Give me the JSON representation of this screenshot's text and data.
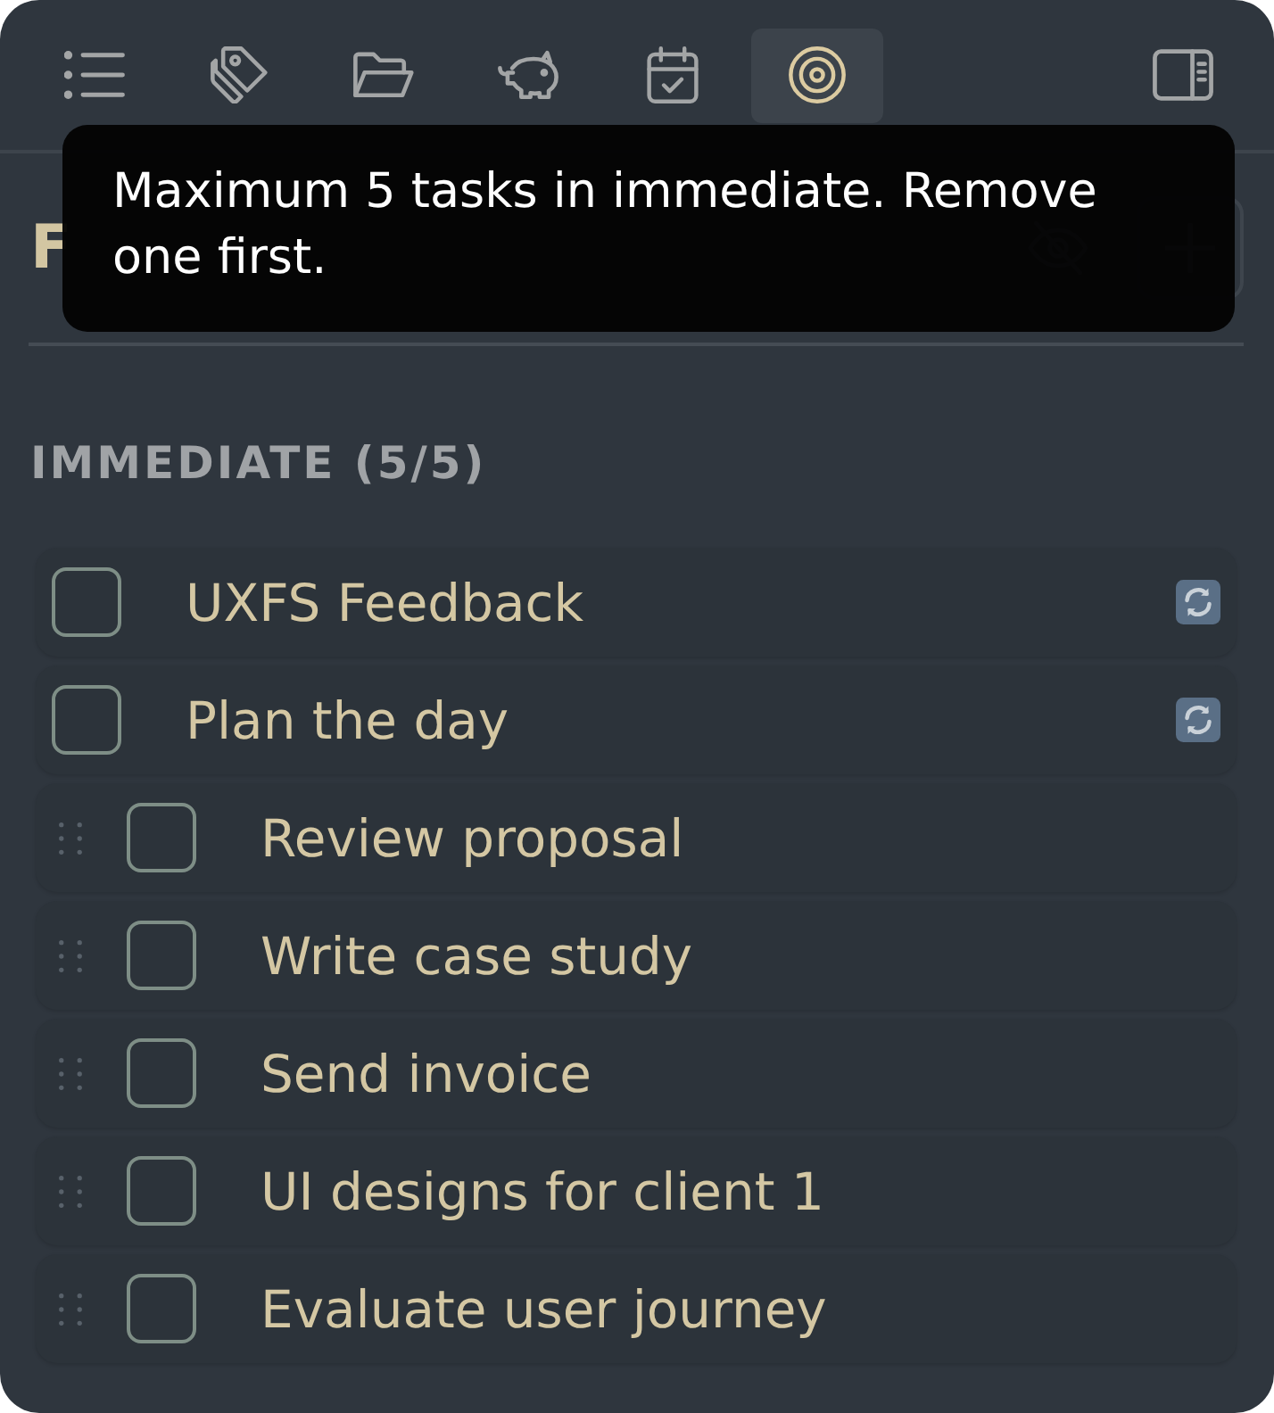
{
  "toolbar": {
    "items": [
      {
        "kind": "list",
        "selected": false
      },
      {
        "kind": "tags",
        "selected": false
      },
      {
        "kind": "folder",
        "selected": false
      },
      {
        "kind": "piggy",
        "selected": false
      },
      {
        "kind": "calendar",
        "selected": false
      },
      {
        "kind": "target",
        "selected": true
      },
      {
        "kind": "panel",
        "selected": false
      }
    ]
  },
  "header": {
    "title": "F"
  },
  "section": {
    "heading": "IMMEDIATE (5/5)",
    "tasks": [
      {
        "kind": "recurring",
        "text": "UXFS Feedback",
        "checked": false
      },
      {
        "kind": "recurring",
        "text": "Plan the day",
        "checked": false
      },
      {
        "kind": "draggable",
        "text": "Review proposal",
        "checked": false
      },
      {
        "kind": "draggable",
        "text": "Write case study",
        "checked": false
      },
      {
        "kind": "draggable",
        "text": "Send invoice",
        "checked": false
      },
      {
        "kind": "draggable",
        "text": "UI designs for client 1",
        "checked": false
      },
      {
        "kind": "draggable",
        "text": "Evaluate user journey",
        "checked": false
      }
    ]
  },
  "tooltip": {
    "text": "Maximum 5 tasks in immediate. Remove one first."
  }
}
